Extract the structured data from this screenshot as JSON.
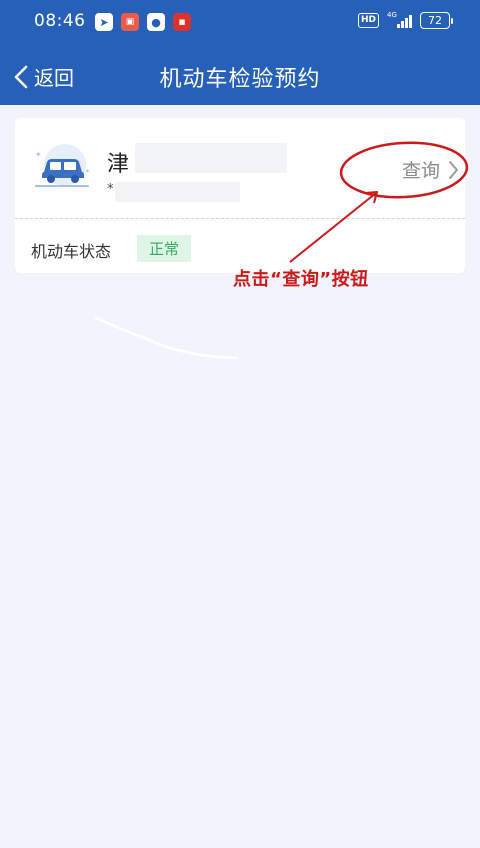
{
  "status_bar": {
    "time": "08:46",
    "notification_icons": [
      "telegram-icon",
      "game-icon",
      "wechat-icon",
      "news-icon"
    ],
    "hd_label": "HD",
    "network": "4G",
    "battery": "72"
  },
  "header": {
    "back_label": "返回",
    "title": "机动车检验预约"
  },
  "vehicle_card": {
    "plate_prefix": "津",
    "sub_text": "*",
    "query_label": "查询",
    "status_label": "机动车状态",
    "status_value": "正常"
  },
  "annotation": {
    "text": "点击“查询”按钮"
  },
  "colors": {
    "header_bg": "#2760b9",
    "page_bg": "#f1f4fa",
    "annotation_red": "#cc1a1a",
    "status_green": "#2fae5d",
    "status_green_bg": "#dff5e7"
  }
}
